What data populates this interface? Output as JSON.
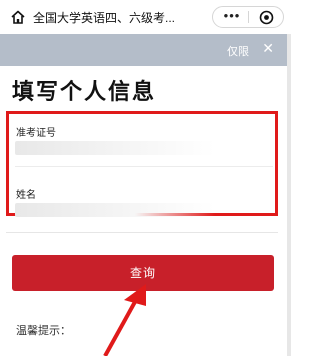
{
  "topbar": {
    "page_name": "全国大学英语四、六级考...",
    "more_label": "•••",
    "icons": [
      "home-icon",
      "more-icon",
      "close-circle-icon"
    ]
  },
  "notice": {
    "label": "仅限",
    "close": "✕"
  },
  "form": {
    "title": "填写个人信息",
    "fields": [
      {
        "label": "准考证号",
        "value": ""
      },
      {
        "label": "姓名",
        "value": ""
      }
    ]
  },
  "actions": {
    "query_label": "查询"
  },
  "tips": {
    "label": "温馨提示："
  },
  "colors": {
    "accent_red": "#c8202a",
    "highlight_box": "#e01a1a",
    "notice_bg": "#b4bdc9"
  }
}
